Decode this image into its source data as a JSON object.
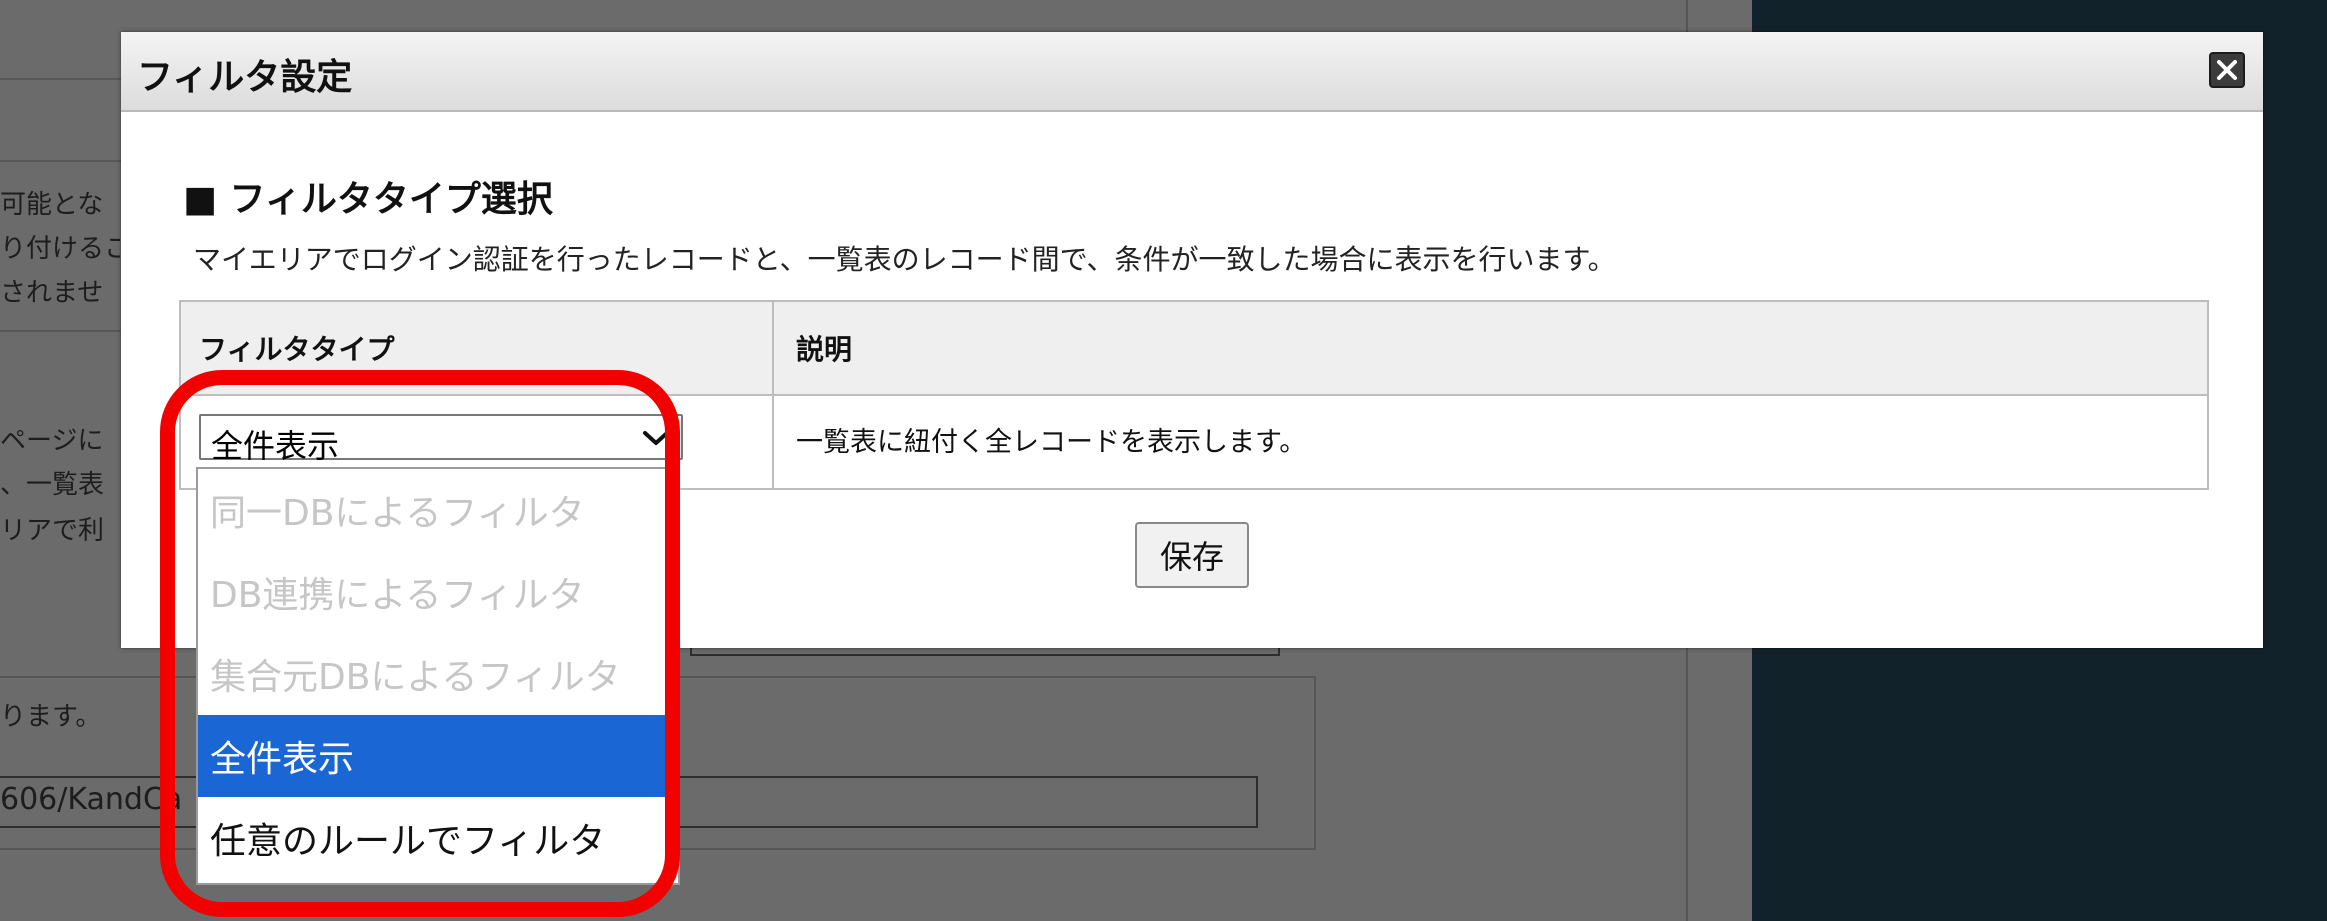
{
  "background": {
    "text_lines": [
      "可能とな",
      "り付けるこ",
      "されませ",
      "ページに",
      "、一覧表",
      "リアで利",
      "ります。"
    ],
    "url_fragment": "606/KandCa"
  },
  "modal": {
    "title": "フィルタ設定",
    "close_icon": "close-icon",
    "section_heading": "■ フィルタタイプ選択",
    "section_description": "マイエリアでログイン認証を行ったレコードと、一覧表のレコード間で、条件が一致した場合に表示を行います。",
    "table": {
      "headers": [
        "フィルタタイプ",
        "説明"
      ],
      "row": {
        "selected_value": "全件表示",
        "description": "一覧表に紐付く全レコードを表示します。"
      }
    },
    "save_label": "保存"
  },
  "dropdown": {
    "options": [
      {
        "label": "同一DBによるフィルタ",
        "state": "disabled"
      },
      {
        "label": "DB連携によるフィルタ",
        "state": "disabled"
      },
      {
        "label": "集合元DBによるフィルタ",
        "state": "disabled"
      },
      {
        "label": "全件表示",
        "state": "selected"
      },
      {
        "label": "任意のルールでフィルタ",
        "state": "normal"
      }
    ]
  },
  "colors": {
    "highlight": "#f20000",
    "selected_option": "#1a66d4",
    "overlay": "#6b6b6b",
    "dark_panel": "#12222b"
  }
}
